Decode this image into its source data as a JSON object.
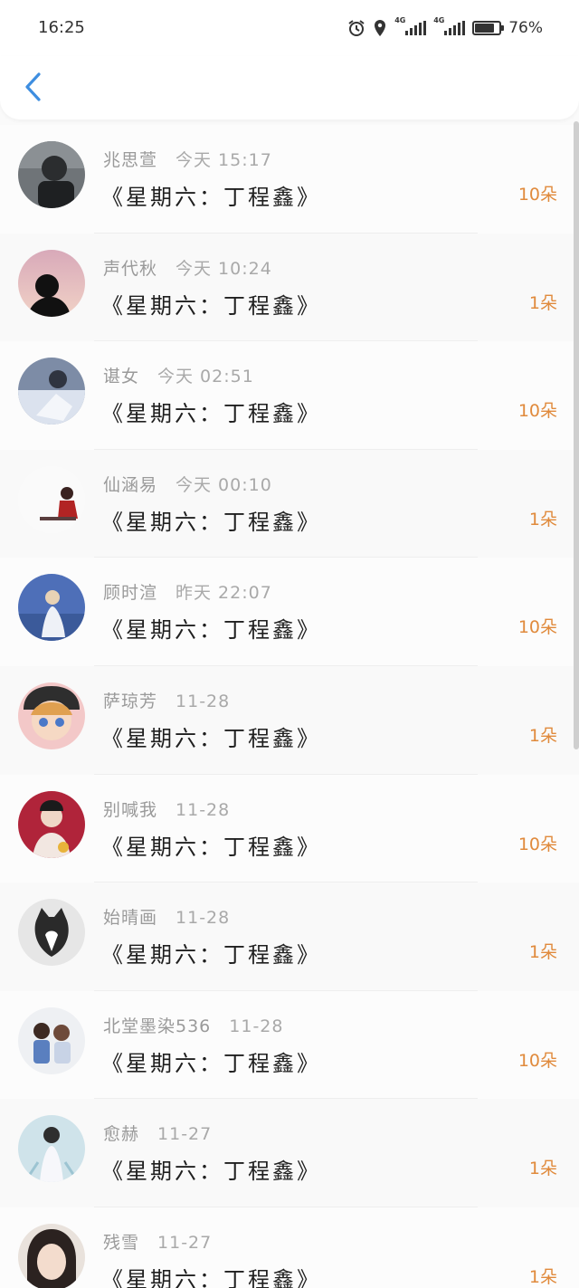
{
  "status_bar": {
    "time": "16:25",
    "network_1": "4G",
    "network_2": "4G",
    "battery_level": 0.76,
    "battery_text": "76%"
  },
  "header": {
    "back_icon": "chevron-left-icon",
    "accent_color": "#3e8ee0"
  },
  "colors": {
    "count": "#e08a3c",
    "meta": "#9a9a9a",
    "title": "#1f1f1f"
  },
  "rows": [
    {
      "username": "兆思萱",
      "time": "今天 15:17",
      "title": "《星期六：丁程鑫》",
      "count": "10朵"
    },
    {
      "username": "声代秋",
      "time": "今天 10:24",
      "title": "《星期六：丁程鑫》",
      "count": "1朵"
    },
    {
      "username": "谌女",
      "time": "今天 02:51",
      "title": "《星期六：丁程鑫》",
      "count": "10朵"
    },
    {
      "username": "仙涵易",
      "time": "今天 00:10",
      "title": "《星期六：丁程鑫》",
      "count": "1朵"
    },
    {
      "username": "顾时渲",
      "time": "昨天 22:07",
      "title": "《星期六：丁程鑫》",
      "count": "10朵"
    },
    {
      "username": "萨琼芳",
      "time": "11-28",
      "title": "《星期六：丁程鑫》",
      "count": "1朵"
    },
    {
      "username": "别喊我",
      "time": "11-28",
      "title": "《星期六：丁程鑫》",
      "count": "10朵"
    },
    {
      "username": "始晴画",
      "time": "11-28",
      "title": "《星期六：丁程鑫》",
      "count": "1朵"
    },
    {
      "username": "北堂墨染536",
      "time": "11-28",
      "title": "《星期六：丁程鑫》",
      "count": "10朵"
    },
    {
      "username": "愈赫",
      "time": "11-27",
      "title": "《星期六：丁程鑫》",
      "count": "1朵"
    },
    {
      "username": "残雪",
      "time": "11-27",
      "title": "《星期六：丁程鑫》",
      "count": "1朵"
    }
  ]
}
